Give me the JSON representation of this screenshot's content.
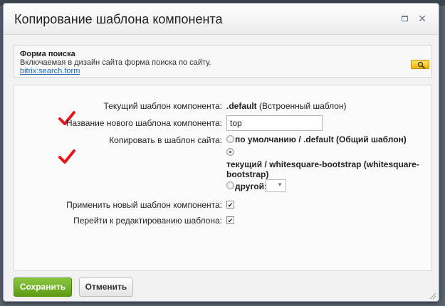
{
  "dialog": {
    "title": "Копирование шаблона компонента"
  },
  "component": {
    "name": "Форма поиска",
    "description": "Включаемая в дизайн сайта форма поиска по сайту.",
    "code": "bitrix:search.form"
  },
  "form": {
    "current_template_label": "Текущий шаблон компонента:",
    "current_template_value": ".default",
    "current_template_note": "(Встроенный шаблон)",
    "new_template_name_label": "Название нового шаблона компонента:",
    "new_template_name_value": "top",
    "copy_to_label": "Копировать в шаблон сайта:",
    "options": {
      "default": "по умолчанию / .default (Общий шаблон)",
      "current_line1": "текущий / whitesquare-bootstrap (whitesquare-",
      "current_line2": "bootstrap)",
      "other": "другой:"
    },
    "selected_option": "current",
    "apply_label": "Применить новый шаблон компонента:",
    "apply_checked": true,
    "edit_label": "Перейти к редактированию шаблона:",
    "edit_checked": true
  },
  "buttons": {
    "save": "Сохранить",
    "cancel": "Отменить"
  },
  "colors": {
    "save_button": "#6aa81f",
    "link": "#2067b0",
    "annotation_checkmark": "#e8141b"
  }
}
